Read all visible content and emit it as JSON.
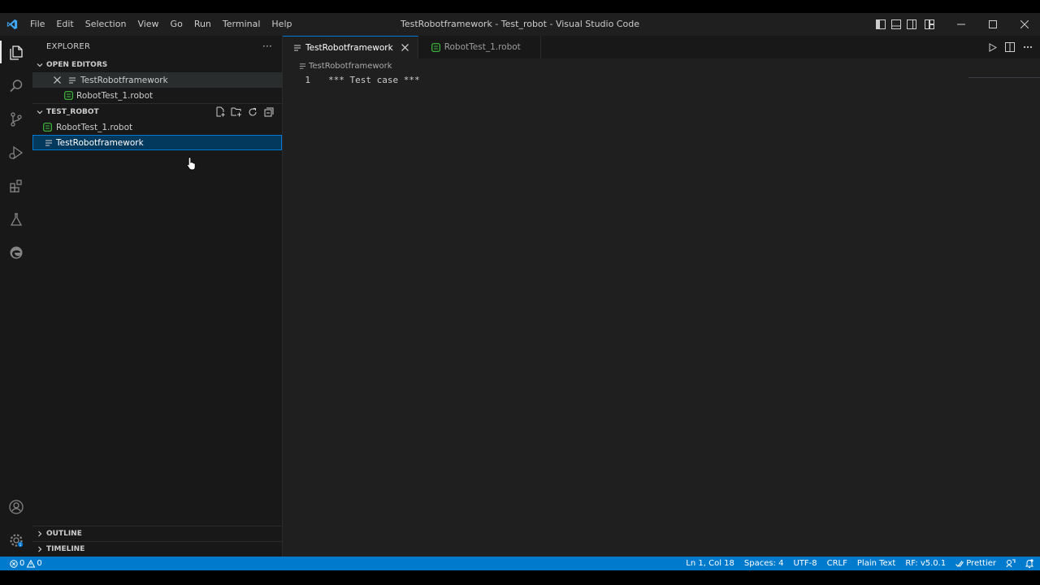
{
  "window": {
    "title": "TestRobotframework - Test_robot - Visual Studio Code"
  },
  "menu": [
    "File",
    "Edit",
    "Selection",
    "View",
    "Go",
    "Run",
    "Terminal",
    "Help"
  ],
  "sidebar": {
    "header": "EXPLORER",
    "open_editors": {
      "title": "OPEN EDITORS",
      "items": [
        {
          "label": "TestRobotframework",
          "icon": "lines-file-icon"
        },
        {
          "label": "RobotTest_1.robot",
          "icon": "robot-file-icon"
        }
      ]
    },
    "folder": {
      "title": "TEST_ROBOT",
      "items": [
        {
          "label": "RobotTest_1.robot",
          "icon": "robot-file-icon"
        },
        {
          "label": "TestRobotframework",
          "icon": "lines-file-icon"
        }
      ]
    },
    "outline": "OUTLINE",
    "timeline": "TIMELINE"
  },
  "editor": {
    "tabs": [
      {
        "label": "TestRobotframework",
        "active": true
      },
      {
        "label": "RobotTest_1.robot",
        "active": false
      }
    ],
    "breadcrumb": "TestRobotframework",
    "lines": [
      {
        "num": "1",
        "text": "*** Test case ***"
      }
    ]
  },
  "statusbar": {
    "errors": "0",
    "warnings": "0",
    "position": "Ln 1, Col 18",
    "spaces": "Spaces: 4",
    "encoding": "UTF-8",
    "eol": "CRLF",
    "language": "Plain Text",
    "rf_version": "RF: v5.0.1",
    "prettier": "Prettier"
  },
  "colors": {
    "accent": "#0078d4",
    "statusbar": "#007acc",
    "robot_icon": "#3fbf3f"
  }
}
